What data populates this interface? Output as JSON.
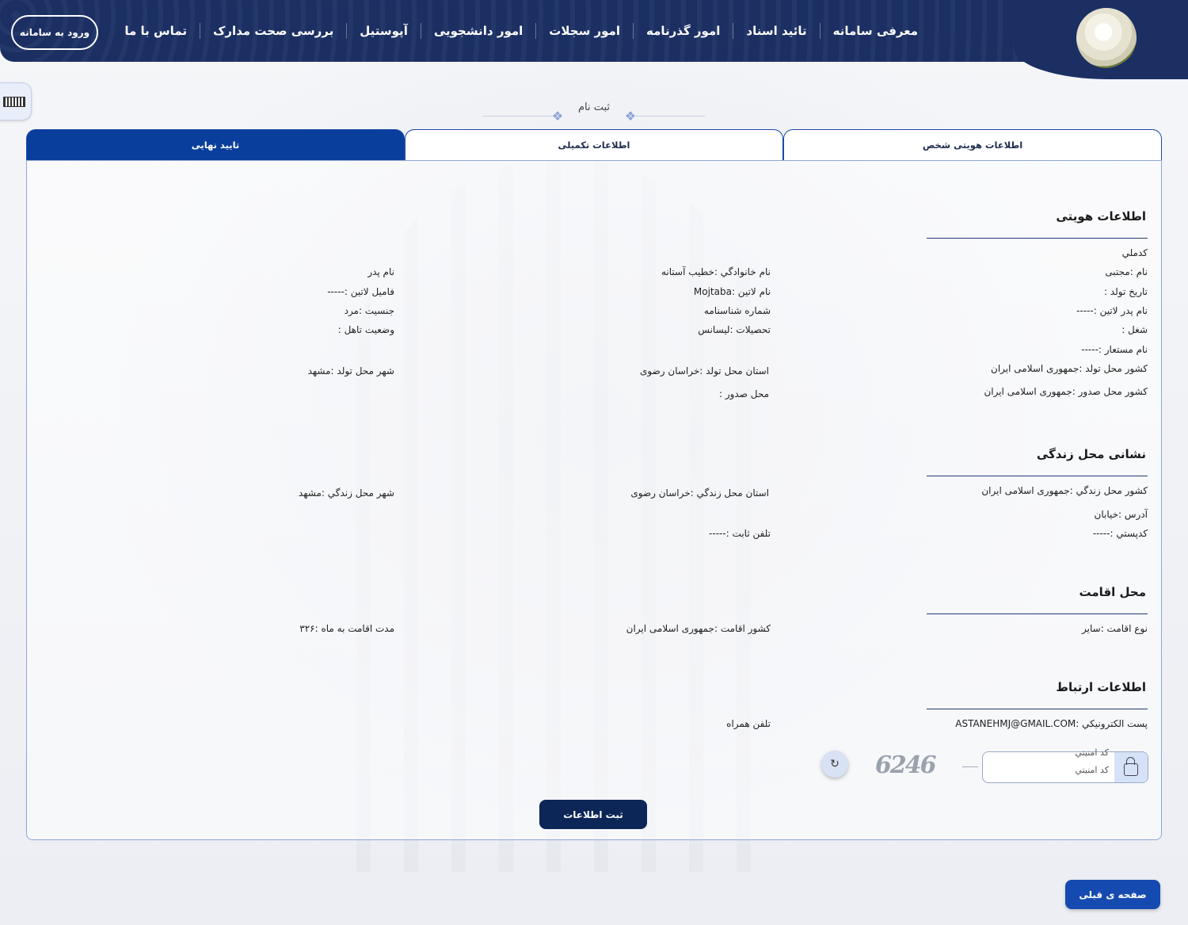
{
  "nav": {
    "items": [
      "معرفی سامانه",
      "تائید اسناد",
      "امور گذرنامه",
      "امور سجلات",
      "امور دانشجویی",
      "آپوستیل",
      "بررسی صحت مدارک",
      "تماس با ما"
    ],
    "login": "ورود به سامانه"
  },
  "page": {
    "title": "ثبت نام"
  },
  "tabs": [
    "اطلاعات هویتی شخص",
    "اطلاعات تکمیلی",
    "تایید نهایی"
  ],
  "identity": {
    "title": "اطلاعات هویتی",
    "national_code": "كدملي",
    "first_name": "نام :مجتبی",
    "birth_date": "تاريخ تولد :",
    "father_latin": "نام پدر لاتين :-----",
    "job": "شغل :",
    "alias": "نام مستعار :-----",
    "birth_country": "كشور محل تولد :جمهوری اسلامی ایران",
    "issue_country": "كشور محل صدور :جمهوری اسلامی ایران",
    "last_name": "نام خانوادگي :خطیب آستانه",
    "latin_name": "نام لاتين :Mojtaba",
    "id_number": "شماره شناسنامه",
    "education": "تحصيلات :ليسانس",
    "birth_province": "استان محل تولد :خراسان رضوی",
    "issue_place": "محل صدور :",
    "father_name": "نام پدر",
    "latin_family": "فاميل لاتين :-----",
    "gender": "جنسيت :مرد",
    "marital": "وضعيت تاهل :",
    "birth_city": "شهر محل تولد :مشهد"
  },
  "address": {
    "title": "نشانی محل زندگی",
    "country": "كشور محل زندگي :جمهوری اسلامی ایران",
    "street": "آدرس :خیابان",
    "postal": "كدپستي :-----",
    "province": "استان محل زندگي :خراسان رضوی",
    "phone": "تلفن ثابت :-----",
    "city": "شهر محل زندگي :مشهد"
  },
  "residence": {
    "title": "محل اقامت",
    "type": "نوع اقامت :ساير",
    "country": "كشور اقامت :جمهوری اسلامی ایران",
    "months": "مدت اقامت به ماه :۳۲۶"
  },
  "contact": {
    "title": "اطلاعات ارتباط",
    "email": "پست الكترونيكي :ASTANEHMJ@GMAIL.COM",
    "mobile": "تلفن همراه",
    "security_label": "كد امنيتي",
    "security_placeholder": "كد امنيتي",
    "captcha": "6246"
  },
  "buttons": {
    "submit": "ثبت اطلاعات",
    "prev": "صفحه ی قبلی"
  }
}
